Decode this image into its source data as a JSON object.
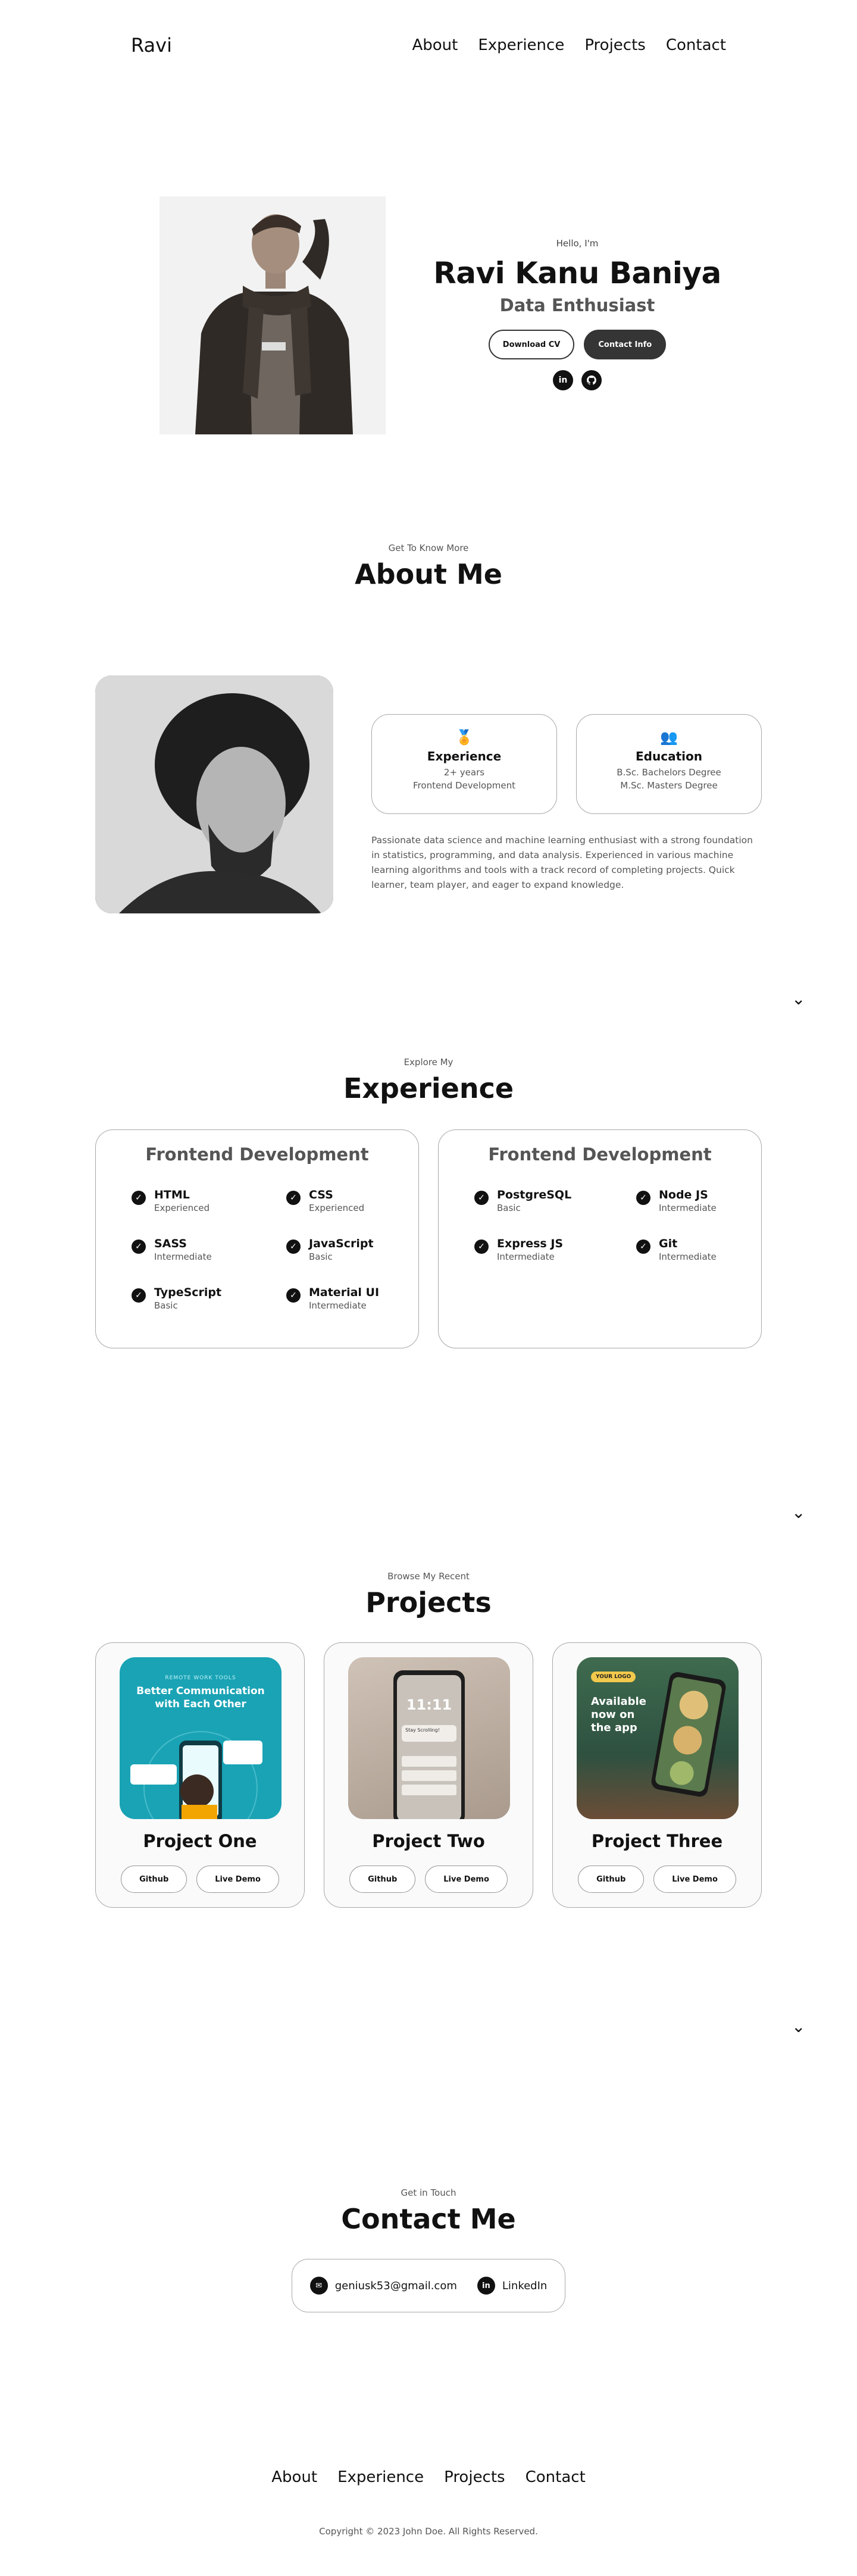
{
  "nav": {
    "logo": "Ravi",
    "links": [
      "About",
      "Experience",
      "Projects",
      "Contact"
    ]
  },
  "hero": {
    "greeting": "Hello, I'm",
    "name": "Ravi Kanu Baniya",
    "role": "Data Enthusiast",
    "btn_cv": "Download CV",
    "btn_contact": "Contact Info",
    "socials": [
      "linkedin-icon",
      "github-icon"
    ]
  },
  "about": {
    "subtitle": "Get To Know More",
    "title": "About Me",
    "cards": [
      {
        "icon": "experience-icon",
        "title": "Experience",
        "lines": [
          "2+ years",
          "Frontend Development"
        ]
      },
      {
        "icon": "education-icon",
        "title": "Education",
        "lines": [
          "B.Sc. Bachelors Degree",
          "M.Sc. Masters Degree"
        ]
      }
    ],
    "description": "Passionate data science and machine learning enthusiast with a strong foundation in statistics, programming, and data analysis. Experienced in various machine learning algorithms and tools with a track record of completing projects. Quick learner, team player, and eager to expand knowledge."
  },
  "experience": {
    "subtitle": "Explore My",
    "title": "Experience",
    "cards": [
      {
        "title": "Frontend Development",
        "skills": [
          {
            "name": "HTML",
            "level": "Experienced"
          },
          {
            "name": "CSS",
            "level": "Experienced"
          },
          {
            "name": "SASS",
            "level": "Intermediate"
          },
          {
            "name": "JavaScript",
            "level": "Basic"
          },
          {
            "name": "TypeScript",
            "level": "Basic"
          },
          {
            "name": "Material UI",
            "level": "Intermediate"
          }
        ]
      },
      {
        "title": "Frontend Development",
        "skills": [
          {
            "name": "PostgreSQL",
            "level": "Basic"
          },
          {
            "name": "Node JS",
            "level": "Intermediate"
          },
          {
            "name": "Express JS",
            "level": "Intermediate"
          },
          {
            "name": "Git",
            "level": "Intermediate"
          }
        ]
      }
    ]
  },
  "projects": {
    "subtitle": "Browse My Recent",
    "title": "Projects",
    "items": [
      {
        "title": "Project One",
        "github": "Github",
        "demo": "Live Demo",
        "img_heading": "Better Communication with Each Other",
        "img_tag": "REMOTE WORK TOOLS"
      },
      {
        "title": "Project Two",
        "github": "Github",
        "demo": "Live Demo",
        "img_heading": "11:11",
        "img_tag": "Stay Scrolling!"
      },
      {
        "title": "Project Three",
        "github": "Github",
        "demo": "Live Demo",
        "img_heading": "Available now on the app",
        "img_tag": "YOUR LOGO"
      }
    ]
  },
  "contact": {
    "subtitle": "Get in Touch",
    "title": "Contact Me",
    "email": "geniusk53@gmail.com",
    "linkedin": "LinkedIn"
  },
  "footer": {
    "links": [
      "About",
      "Experience",
      "Projects",
      "Contact"
    ],
    "copyright": "Copyright © 2023 John Doe. All Rights Reserved."
  }
}
